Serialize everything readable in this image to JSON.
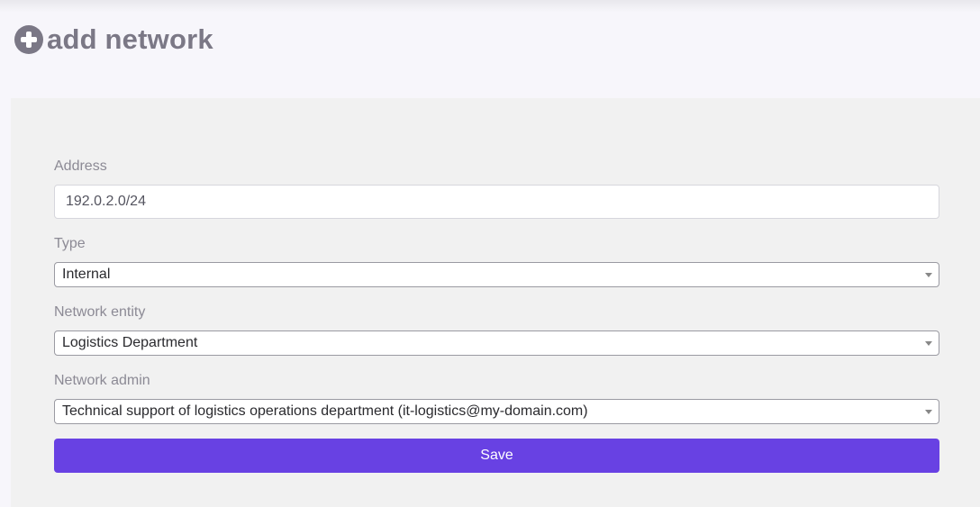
{
  "header": {
    "icon": "plus-circle-icon",
    "title": "add network"
  },
  "form": {
    "address": {
      "label": "Address",
      "value": "192.0.2.0/24"
    },
    "type": {
      "label": "Type",
      "selected": "Internal"
    },
    "network_entity": {
      "label": "Network entity",
      "selected": "Logistics Department"
    },
    "network_admin": {
      "label": "Network admin",
      "selected": "Technical support of logistics operations department (it-logistics@my-domain.com)"
    },
    "save_label": "Save"
  },
  "colors": {
    "accent": "#6841e3",
    "page_background": "#f7f6fb",
    "panel_background": "#f1f1f1",
    "muted_text": "#7b7886"
  }
}
